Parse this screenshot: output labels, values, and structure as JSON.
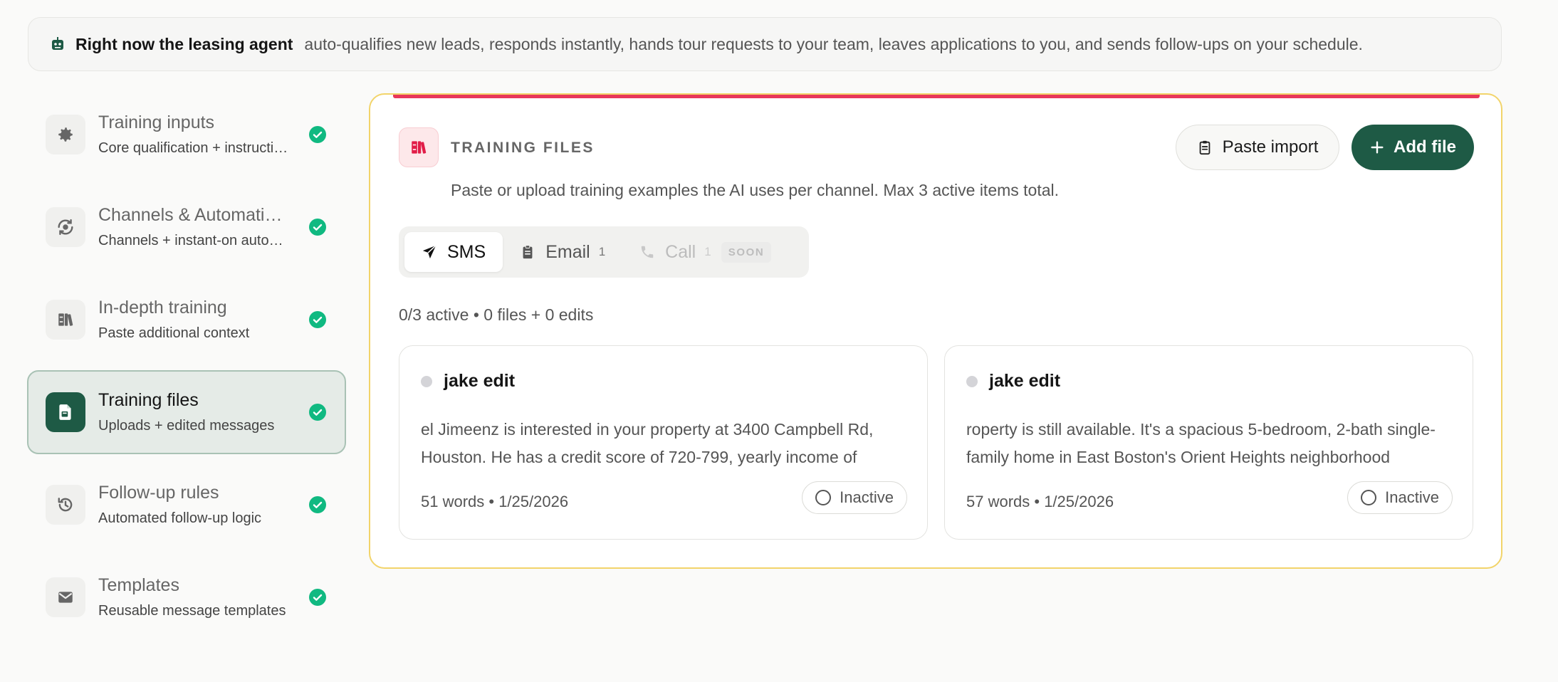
{
  "banner": {
    "title": "Right now the leasing agent",
    "text": "auto-qualifies new leads, responds instantly, hands tour requests to your team, leaves applications to you, and sends follow-ups on your schedule.",
    "icon": "robot-icon"
  },
  "sidebar": {
    "items": [
      {
        "title": "Training inputs",
        "subtitle": "Core qualification + instructions",
        "icon": "gear-icon",
        "status": "complete"
      },
      {
        "title": "Channels & Automations",
        "subtitle": "Channels + instant-on automations",
        "icon": "channels-icon",
        "status": "complete"
      },
      {
        "title": "In-depth training",
        "subtitle": "Paste additional context",
        "icon": "books-icon",
        "status": "complete"
      },
      {
        "title": "Training files",
        "subtitle": "Uploads + edited messages",
        "icon": "file-icon",
        "status": "complete",
        "active": true
      },
      {
        "title": "Follow-up rules",
        "subtitle": "Automated follow-up logic",
        "icon": "history-icon",
        "status": "complete"
      },
      {
        "title": "Templates",
        "subtitle": "Reusable message templates",
        "icon": "mail-icon",
        "status": "complete"
      }
    ]
  },
  "panel": {
    "title": "TRAINING FILES",
    "description": "Paste or upload training examples the AI uses per channel. Max 3 active items total.",
    "paste_import_label": "Paste import",
    "add_file_label": "Add file",
    "tabs": [
      {
        "label": "SMS",
        "count": "",
        "icon": "send-icon",
        "active": true
      },
      {
        "label": "Email",
        "count": "1",
        "icon": "clipboard-icon"
      },
      {
        "label": "Call",
        "count": "1",
        "icon": "phone-icon",
        "badge": "SOON",
        "disabled": true
      }
    ],
    "summary": "0/3 active • 0 files + 0 edits",
    "cards": [
      {
        "title": "jake edit",
        "body": "el Jimeenz is interested in your property at 3400 Campbell Rd, Houston. He has a credit score of 720-799, yearly income of",
        "meta": "51 words • 1/25/2026",
        "status": "Inactive"
      },
      {
        "title": "jake edit",
        "body": "roperty is still available. It's a spacious 5-bedroom, 2-bath single-family home in East Boston's Orient Heights neighborhood",
        "meta": "57 words • 1/25/2026",
        "status": "Inactive"
      }
    ]
  },
  "colors": {
    "accent_green": "#1e5a45",
    "check_green": "#10b981",
    "alert_red": "#e8375a",
    "panel_border": "#f2d46a"
  }
}
